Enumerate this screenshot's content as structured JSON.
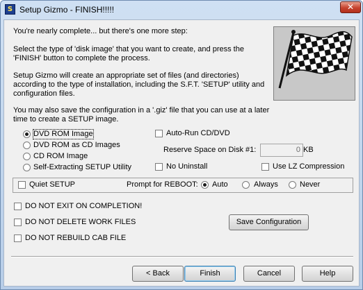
{
  "window": {
    "title": "Setup Gizmo - FINISH!!!!!",
    "close_glyph": "✕"
  },
  "intro": {
    "line1": "You're nearly complete... but there's one more step:",
    "line2": "Select the type of 'disk image' that you want to create, and press the 'FINISH' button to complete the process.",
    "line3": "Setup Gizmo will create an appropriate set of files (and directories) according to the type of installation, including the S.F.T. 'SETUP' utility and configuration files.",
    "line4": "You may also save the configuration in a '.giz' file that you can use at a later time to create a SETUP image."
  },
  "image_type": {
    "selected": "DVD ROM Image",
    "options": [
      "DVD ROM Image",
      "DVD ROM as CD Images",
      "CD ROM Image",
      "Self-Extracting SETUP Utility"
    ]
  },
  "options": {
    "auto_run": {
      "label": "Auto-Run CD/DVD",
      "checked": false
    },
    "reserve_space": {
      "label": "Reserve Space on Disk #1:",
      "value": "0",
      "unit": "KB"
    },
    "no_uninstall": {
      "label": "No Uninstall",
      "checked": false
    },
    "lz_compression": {
      "label": "Use LZ Compression",
      "checked": false
    }
  },
  "reboot_group": {
    "quiet_setup": {
      "label": "Quiet SETUP",
      "checked": false
    },
    "prompt_label": "Prompt for REBOOT:",
    "selected": "Auto",
    "options": [
      "Auto",
      "Always",
      "Never"
    ]
  },
  "flags": {
    "no_exit": {
      "label": "DO NOT EXIT ON COMPLETION!",
      "checked": false
    },
    "no_delete": {
      "label": "DO NOT DELETE WORK FILES",
      "checked": false
    },
    "no_rebuild": {
      "label": "DO NOT REBUILD CAB FILE",
      "checked": false
    }
  },
  "buttons": {
    "save_config": "Save Configuration",
    "back": "< Back",
    "finish": "Finish",
    "cancel": "Cancel",
    "help": "Help"
  },
  "icons": {
    "app": "setup-gizmo-icon",
    "flag": "checkered-flag-icon",
    "close": "close-icon"
  }
}
